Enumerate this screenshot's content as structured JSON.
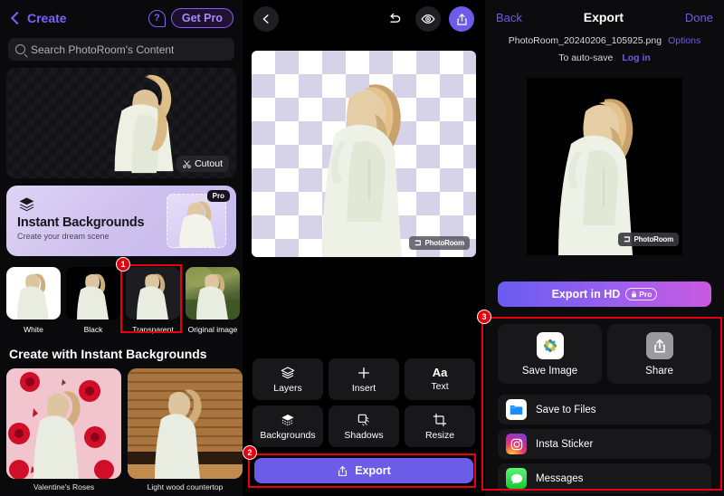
{
  "app": {
    "name": "PhotoRoom",
    "accent": "#6c5ce7",
    "annotation_color": "#e8000d"
  },
  "left_panel": {
    "back_label": "Create",
    "help_icon": "question-mark-icon",
    "get_pro_label": "Get Pro",
    "search": {
      "placeholder": "Search PhotoRoom's Content",
      "icon": "search-icon"
    },
    "hero": {
      "badge_label": "Cutout",
      "badge_icon": "scissors-icon"
    },
    "instant_backgrounds_card": {
      "title": "Instant Backgrounds",
      "subtitle": "Create your dream scene",
      "pro_badge": "Pro",
      "icon": "layers-stack-icon"
    },
    "background_thumbs": [
      {
        "label": "White",
        "selected": false
      },
      {
        "label": "Black",
        "selected": false
      },
      {
        "label": "Transparent",
        "selected": true
      },
      {
        "label": "Original image",
        "selected": false
      }
    ],
    "section_title": "Create with Instant Backgrounds",
    "gallery": [
      {
        "label": "Valentine's Roses"
      },
      {
        "label": "Light wood countertop"
      }
    ]
  },
  "mid_panel": {
    "back_icon": "chevron-left-icon",
    "undo_icon": "undo-arrow-icon",
    "preview_icon": "eye-icon",
    "share_icon": "share-upload-icon",
    "canvas": {
      "watermark": "PhotoRoom",
      "background": "transparent-checkerboard"
    },
    "tools": [
      {
        "label": "Layers",
        "icon": "layers-icon"
      },
      {
        "label": "Insert",
        "icon": "plus-icon"
      },
      {
        "label": "Text",
        "icon": "aa-text-icon"
      },
      {
        "label": "Backgrounds",
        "icon": "backgrounds-icon"
      },
      {
        "label": "Shadows",
        "icon": "shadows-icon"
      },
      {
        "label": "Resize",
        "icon": "crop-resize-icon"
      }
    ],
    "export_button": {
      "label": "Export",
      "icon": "share-upload-icon"
    }
  },
  "right_panel": {
    "back_label": "Back",
    "title": "Export",
    "done_label": "Done",
    "filename": "PhotoRoom_20240206_105925.png",
    "options_label": "Options",
    "autosave_text": "To auto-save",
    "login_label": "Log in",
    "preview_watermark": "PhotoRoom",
    "export_hd": {
      "label": "Export in HD",
      "pro_badge": "Pro",
      "lock_icon": "lock-icon"
    },
    "big_actions": [
      {
        "label": "Save Image",
        "icon": "photos-app-icon"
      },
      {
        "label": "Share",
        "icon": "share-upload-icon"
      }
    ],
    "share_rows": [
      {
        "label": "Save to Files",
        "icon": "files-app-icon"
      },
      {
        "label": "Insta Sticker",
        "icon": "instagram-icon"
      },
      {
        "label": "Messages",
        "icon": "messages-app-icon"
      }
    ]
  },
  "annotations": [
    {
      "number": "1",
      "target": "transparent-background-thumb"
    },
    {
      "number": "2",
      "target": "export-button"
    },
    {
      "number": "3",
      "target": "share-destinations-group"
    }
  ]
}
